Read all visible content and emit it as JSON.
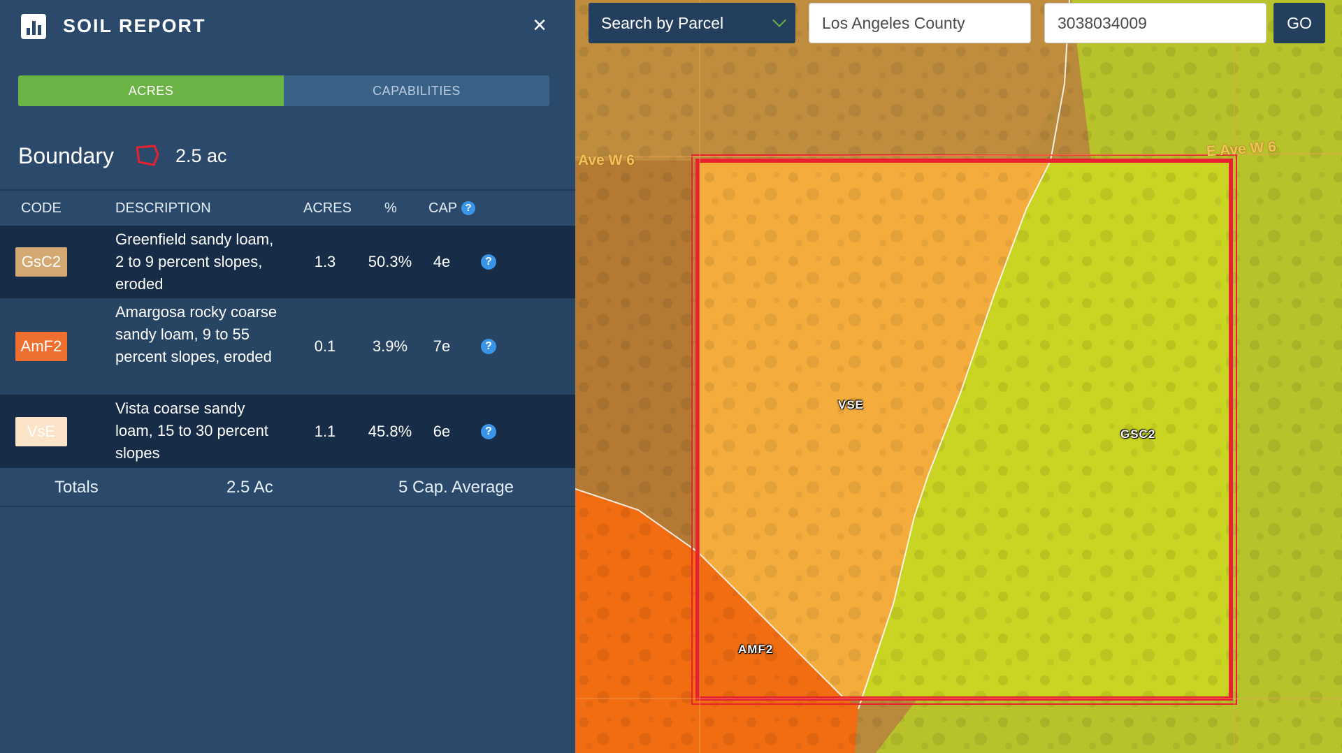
{
  "header": {
    "title": "SOIL REPORT",
    "close": "×"
  },
  "tabs": [
    {
      "label": "ACRES",
      "active": true
    },
    {
      "label": "CAPABILITIES",
      "active": false
    }
  ],
  "boundary": {
    "label": "Boundary",
    "value": "2.5 ac"
  },
  "table": {
    "headers": {
      "code": "CODE",
      "description": "DESCRIPTION",
      "acres": "ACRES",
      "percent": "%",
      "cap": "CAP"
    },
    "rows": [
      {
        "code": "GsC2",
        "code_color": "#d4a871",
        "code_text_color": "#ffffff",
        "description": "Greenfield sandy loam, 2 to 9 percent slopes, eroded",
        "acres": "1.3",
        "percent": "50.3%",
        "cap": "4e"
      },
      {
        "code": "AmF2",
        "code_color": "#ef6f2e",
        "code_text_color": "#ffffff",
        "description": "Amargosa rocky coarse sandy loam, 9 to 55 percent slopes, eroded",
        "acres": "0.1",
        "percent": "3.9%",
        "cap": "7e"
      },
      {
        "code": "VsE",
        "code_color": "#fbe3c8",
        "code_text_color": "#ffffff",
        "description": "Vista coarse sandy loam, 15 to 30 percent slopes",
        "acres": "1.1",
        "percent": "45.8%",
        "cap": "6e"
      }
    ],
    "totals": {
      "label": "Totals",
      "acres": "2.5 Ac",
      "cap": "5 Cap. Average"
    }
  },
  "search": {
    "mode": "Search by Parcel",
    "county": "Los Angeles County",
    "parcel": "3038034009",
    "go": "GO"
  },
  "map": {
    "labels": {
      "vse": "VSE",
      "gsc2": "GSC2",
      "amf2": "AMF2"
    },
    "streets": {
      "left": "Ave W 6",
      "right": "E Ave W 6"
    },
    "colors": {
      "vse": "#f4ad3d",
      "gsc2": "#c9d423",
      "amf2": "#f26d12",
      "boundary": "#e8202f"
    }
  },
  "icons": {
    "logo": "bar-chart-icon",
    "boundary": "polygon-outline-icon",
    "help": "question-circle-icon",
    "dropdown": "chevron-down-icon"
  }
}
